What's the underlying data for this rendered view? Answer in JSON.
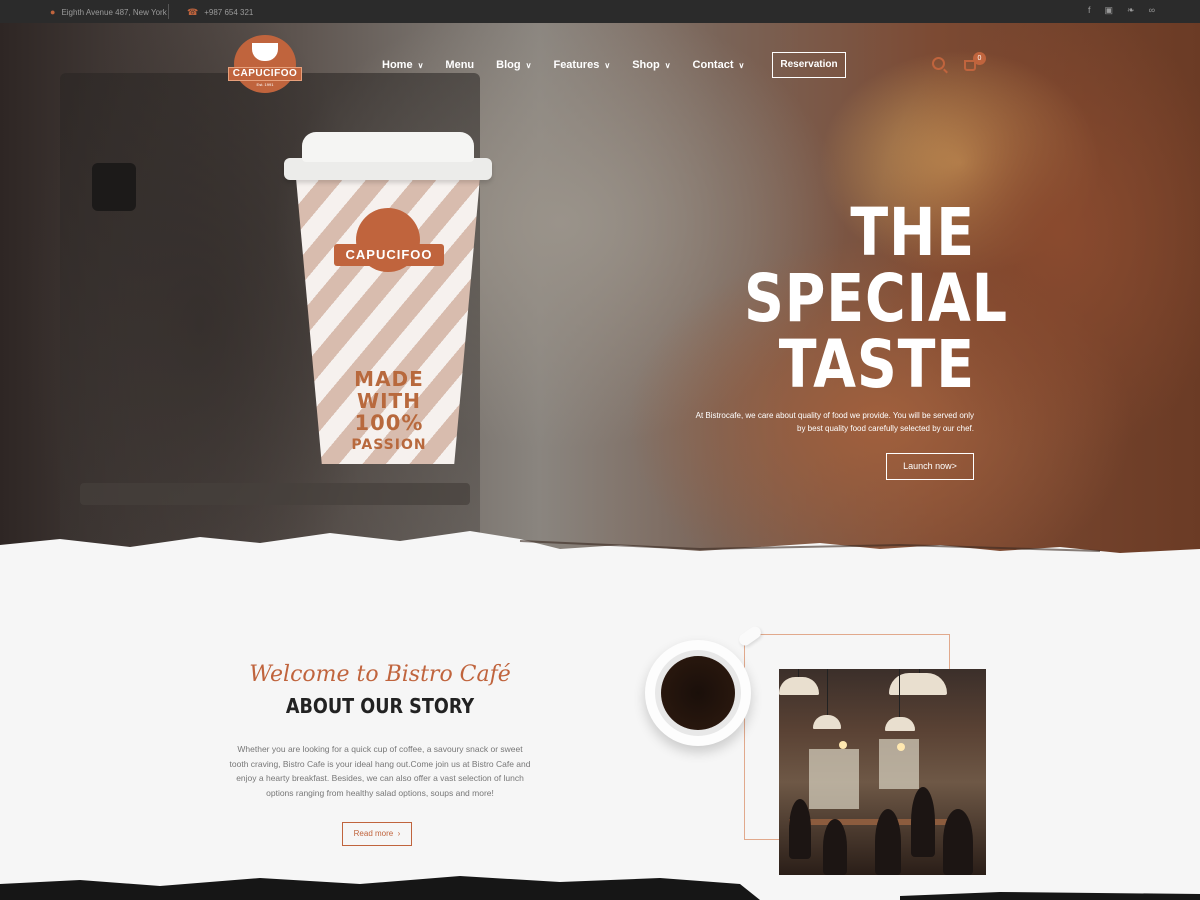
{
  "topbar": {
    "address": "Eighth Avenue 487, New York",
    "phone": "+987 654 321",
    "social_icons": [
      "facebook-icon",
      "instagram-icon",
      "twitter-icon",
      "tripadvisor-icon"
    ]
  },
  "brand": {
    "name": "CAPUCIFOO",
    "established": "Est. 1991",
    "accent_color": "#c0643d"
  },
  "nav": {
    "items": [
      {
        "label": "Home",
        "has_dropdown": true
      },
      {
        "label": "Menu",
        "has_dropdown": false
      },
      {
        "label": "Blog",
        "has_dropdown": true
      },
      {
        "label": "Features",
        "has_dropdown": true
      },
      {
        "label": "Shop",
        "has_dropdown": true
      },
      {
        "label": "Contact",
        "has_dropdown": true
      }
    ],
    "reservation_label": "Reservation",
    "cart_count": "0"
  },
  "hero": {
    "title_line1": "THE",
    "title_line2": "SPECIAL",
    "title_line3": "TASTE",
    "description": "At Bistrocafe, we care about quality of food we provide. You will be served only by best quality food carefully selected by our chef.",
    "button_label": "Launch now>",
    "cup_text_line1": "MADE",
    "cup_text_line2": "WITH",
    "cup_text_line3": "100%",
    "cup_text_line4": "PASSION",
    "cup_brand": "CAPUCIFOO"
  },
  "about": {
    "welcome": "Welcome to Bistro Café",
    "heading": "ABOUT OUR STORY",
    "body": "Whether you are looking for a quick cup of coffee, a savoury snack or sweet tooth craving, Bistro Cafe is your ideal hang out.Come join us at Bistro Cafe and enjoy a hearty breakfast. Besides, we can also offer a vast selection of lunch options ranging from healthy salad options, soups and more!",
    "button_label": "Read more"
  }
}
